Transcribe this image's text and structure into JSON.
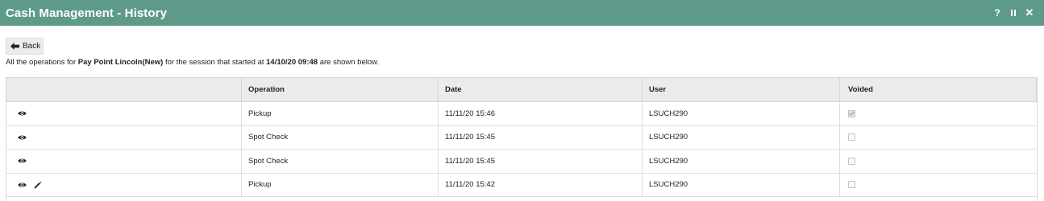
{
  "window": {
    "title": "Cash Management - History",
    "help_label": "?",
    "close_label": "✕"
  },
  "back_button": {
    "label": "Back"
  },
  "info": {
    "prefix": "All the operations for ",
    "pay_point": "Pay Point Lincoln(New)",
    "middle": " for the session that started at ",
    "session_start": "14/10/20 09:48",
    "suffix": " are shown below."
  },
  "table": {
    "columns": [
      "",
      "Operation",
      "Date",
      "User",
      "Voided"
    ],
    "rows": [
      {
        "operation": "Pickup",
        "date": "11/11/20 15:46",
        "user": "LSUCH290",
        "voided": true,
        "editable": false
      },
      {
        "operation": "Spot Check",
        "date": "11/11/20 15:45",
        "user": "LSUCH290",
        "voided": false,
        "editable": false
      },
      {
        "operation": "Spot Check",
        "date": "11/11/20 15:45",
        "user": "LSUCH290",
        "voided": false,
        "editable": false
      },
      {
        "operation": "Pickup",
        "date": "11/11/20 15:42",
        "user": "LSUCH290",
        "voided": false,
        "editable": true
      }
    ]
  },
  "colors": {
    "titlebar": "#5e9a89",
    "header_bg": "#ebebeb"
  },
  "icons": {
    "view": "eye-icon",
    "edit": "pencil-icon",
    "back": "arrow-left-icon",
    "pause": "pause-icon",
    "close": "close-icon",
    "help": "help-icon"
  }
}
